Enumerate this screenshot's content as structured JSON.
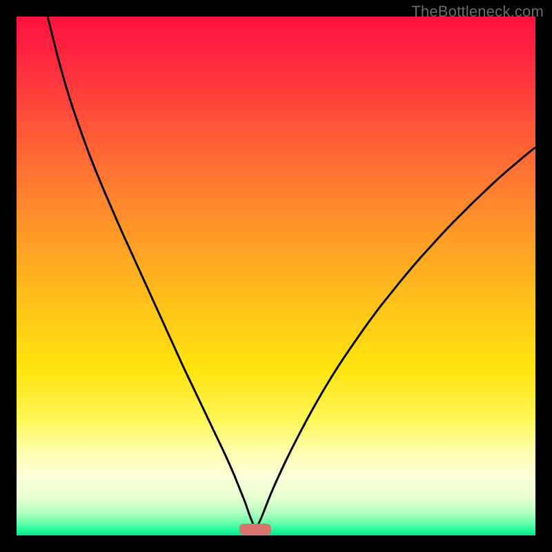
{
  "watermark": "TheBottleneck.com",
  "colors": {
    "gradient_stops": [
      {
        "offset": 0.0,
        "color": "#ff123f"
      },
      {
        "offset": 0.08,
        "color": "#ff2740"
      },
      {
        "offset": 0.18,
        "color": "#ff4a3a"
      },
      {
        "offset": 0.3,
        "color": "#ff7432"
      },
      {
        "offset": 0.42,
        "color": "#ff9a28"
      },
      {
        "offset": 0.55,
        "color": "#ffc21a"
      },
      {
        "offset": 0.68,
        "color": "#ffe40e"
      },
      {
        "offset": 0.78,
        "color": "#fff65a"
      },
      {
        "offset": 0.84,
        "color": "#ffffb0"
      },
      {
        "offset": 0.885,
        "color": "#fbffd9"
      },
      {
        "offset": 0.925,
        "color": "#e8ffd0"
      },
      {
        "offset": 0.955,
        "color": "#b6ffc0"
      },
      {
        "offset": 0.975,
        "color": "#6bffae"
      },
      {
        "offset": 0.99,
        "color": "#22f79c"
      },
      {
        "offset": 1.0,
        "color": "#06e58a"
      }
    ],
    "curve_stroke": "#000000",
    "marker_fill": "#d9736d",
    "marker_stroke": "#d9736d"
  },
  "chart_data": {
    "type": "line",
    "title": "",
    "xlabel": "",
    "ylabel": "",
    "xlim": [
      0,
      100
    ],
    "ylim": [
      0,
      100
    ],
    "grid": false,
    "legend": false,
    "marker": {
      "x": 46,
      "y": 1.2,
      "width": 6,
      "height": 2.0
    },
    "series": [
      {
        "name": "left-curve",
        "x": [
          6,
          8,
          10,
          12,
          14,
          16,
          18,
          20,
          22,
          24,
          26,
          28,
          30,
          32,
          34,
          36,
          38,
          40,
          41,
          42,
          43,
          44,
          44.8,
          45.5,
          46
        ],
        "y": [
          100,
          92,
          85,
          79,
          73.5,
          68.5,
          63.8,
          59.2,
          54.8,
          50.4,
          46.0,
          41.6,
          37.2,
          32.8,
          28.6,
          24.4,
          20.2,
          16.0,
          13.8,
          11.5,
          9.0,
          6.5,
          4.2,
          2.4,
          1.0
        ]
      },
      {
        "name": "right-curve",
        "x": [
          46,
          47,
          48,
          49,
          50,
          52,
          54,
          56,
          58,
          60,
          62,
          64,
          66,
          68,
          70,
          72,
          74,
          76,
          78,
          80,
          82,
          84,
          86,
          88,
          90,
          92,
          94,
          96,
          98,
          100
        ],
        "y": [
          1.0,
          3.0,
          5.5,
          8.0,
          10.3,
          14.6,
          18.6,
          22.4,
          26.0,
          29.4,
          32.6,
          35.6,
          38.5,
          41.3,
          44.0,
          46.5,
          49.0,
          51.4,
          53.7,
          55.9,
          58.1,
          60.2,
          62.2,
          64.2,
          66.1,
          68.0,
          69.8,
          71.5,
          73.2,
          74.8
        ]
      }
    ]
  }
}
